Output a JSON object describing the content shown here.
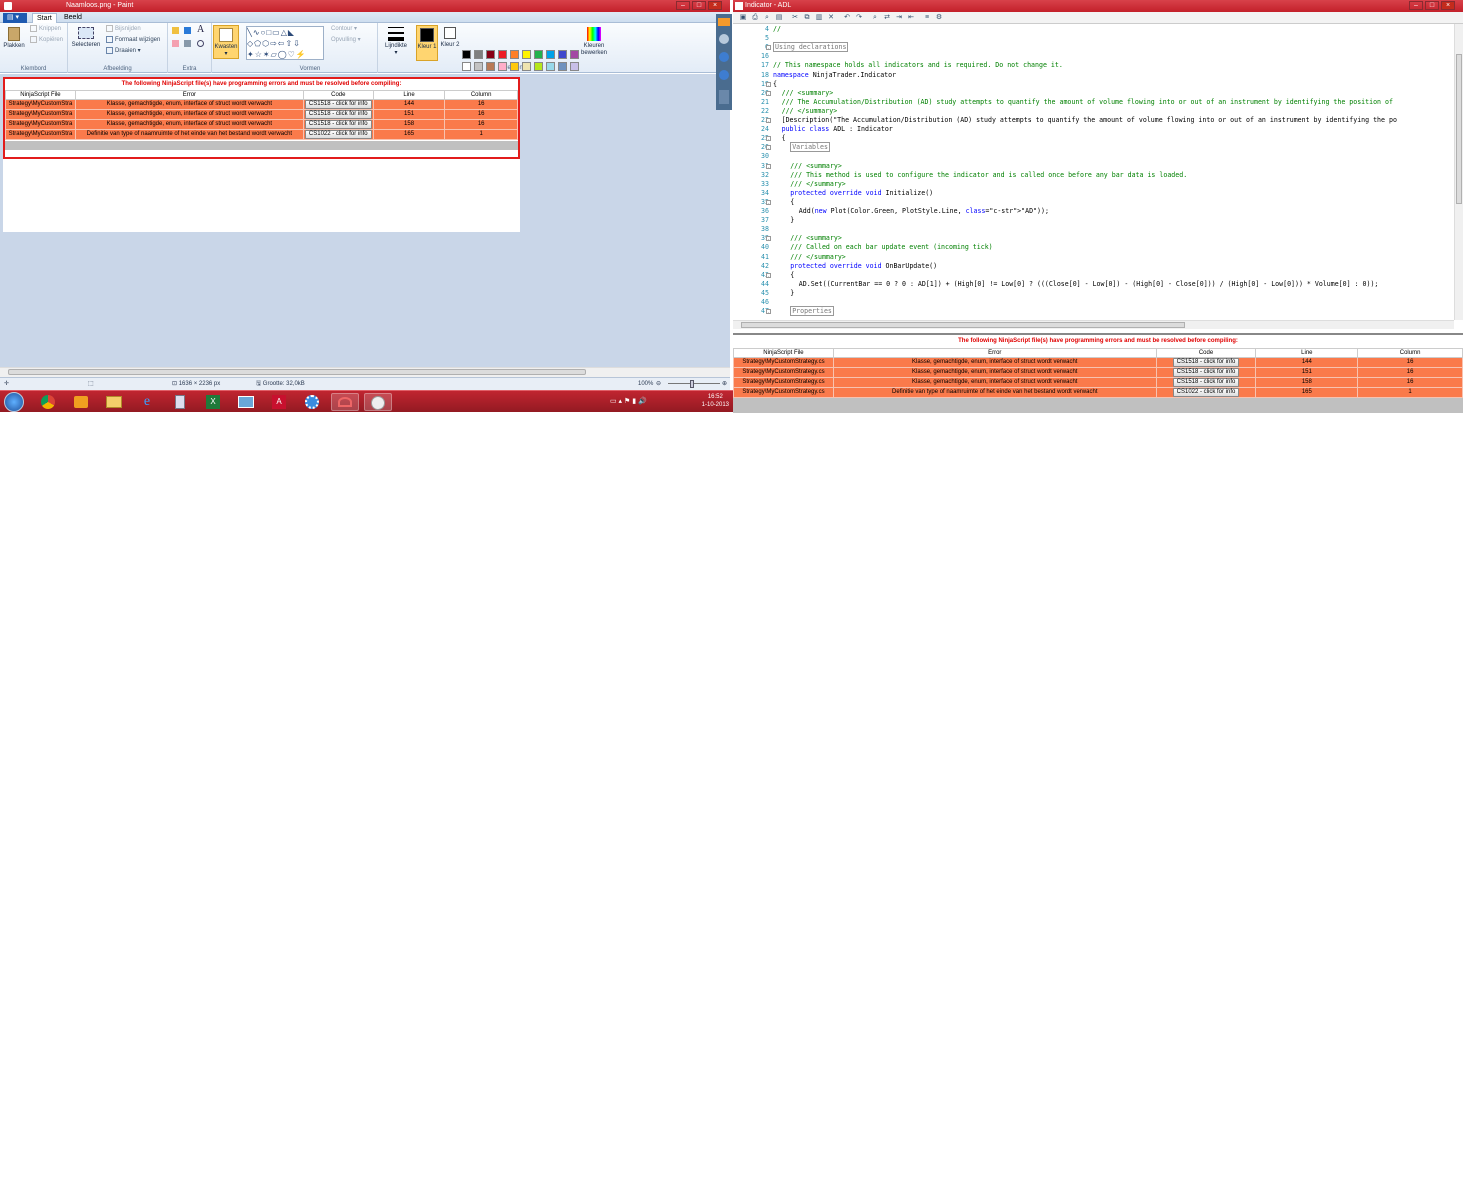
{
  "paint": {
    "title": "Naamloos.png - Paint",
    "tabs": [
      "Start",
      "Beeld"
    ],
    "groups": {
      "klembord": {
        "label": "Klembord",
        "paste": "Plakken",
        "cut": "Knippen",
        "copy": "Kopiëren"
      },
      "afbeelding": {
        "label": "Afbeelding",
        "select": "Selecteren",
        "crop": "Bijsnijden",
        "resize": "Formaat wijzigen",
        "rotate": "Draaien"
      },
      "extra": {
        "label": "Extra"
      },
      "brushes": {
        "label": "Kwasten"
      },
      "vormen": {
        "label": "Vormen",
        "contour": "Contour",
        "fill": "Opvulling"
      },
      "lijndikte": {
        "label": "Lijndikte"
      },
      "kleuren": {
        "label": "Kleuren",
        "color1": "Kleur 1",
        "color2": "Kleur 2",
        "edit": "Kleuren bewerken"
      }
    },
    "palette": [
      "#000000",
      "#7f7f7f",
      "#880015",
      "#ed1c24",
      "#ff7f27",
      "#fff200",
      "#22b14c",
      "#00a2e8",
      "#3f48cc",
      "#a349a4",
      "#ffffff",
      "#c3c3c3",
      "#b97a57",
      "#ffaec9",
      "#ffc90e",
      "#efe4b0",
      "#b5e61d",
      "#99d9ea",
      "#7092be",
      "#c8bfe7"
    ],
    "status": {
      "dimensions": "1636 × 2236 px",
      "size": "Grootte: 32,0kB",
      "zoom": "100%"
    }
  },
  "errors_small": {
    "title": "The following NinjaScript file(s) have programming errors and must be resolved before compiling:",
    "headers": [
      "NinjaScript File",
      "Error",
      "Code",
      "Line",
      "Column"
    ],
    "rows": [
      {
        "file": "Strategy\\MyCustomStra",
        "error": "Klasse, gemachtigde, enum, interface of struct wordt verwacht",
        "code": "CS1518 - click for info",
        "line": "144",
        "col": "16"
      },
      {
        "file": "Strategy\\MyCustomStra",
        "error": "Klasse, gemachtigde, enum, interface of struct wordt verwacht",
        "code": "CS1518 - click for info",
        "line": "151",
        "col": "16"
      },
      {
        "file": "Strategy\\MyCustomStra",
        "error": "Klasse, gemachtigde, enum, interface of struct wordt verwacht",
        "code": "CS1518 - click for info",
        "line": "158",
        "col": "16"
      },
      {
        "file": "Strategy\\MyCustomStra",
        "error": "Definitie van type of naamruimte of het einde van het bestand wordt verwacht",
        "code": "CS1022 - click for info",
        "line": "165",
        "col": "1"
      }
    ]
  },
  "ninja": {
    "title": "Indicator - ADL",
    "lines": [
      {
        "n": "4",
        "text": "//"
      },
      {
        "n": "5",
        "text": ""
      },
      {
        "n": "6",
        "text": "Using declarations"
      },
      {
        "n": "16",
        "text": ""
      },
      {
        "n": "17",
        "text": "// This namespace holds all indicators and is required. Do not change it."
      },
      {
        "n": "18",
        "text": "namespace NinjaTrader.Indicator"
      },
      {
        "n": "19",
        "text": "{"
      },
      {
        "n": "20",
        "text": "/// <summary>"
      },
      {
        "n": "21",
        "text": "/// The Accumulation/Distribution (AD) study attempts to quantify the amount of volume flowing into or out of an instrument by identifying the position of"
      },
      {
        "n": "22",
        "text": "/// </summary>"
      },
      {
        "n": "23",
        "text": "[Description(\"The Accumulation/Distribution (AD) study attempts to quantify the amount of volume flowing into or out of an instrument by identifying the po"
      },
      {
        "n": "24",
        "text": "public class ADL : Indicator"
      },
      {
        "n": "25",
        "text": "{"
      },
      {
        "n": "26",
        "text": "Variables"
      },
      {
        "n": "30",
        "text": ""
      },
      {
        "n": "31",
        "text": "/// <summary>"
      },
      {
        "n": "32",
        "text": "/// This method is used to configure the indicator and is called once before any bar data is loaded."
      },
      {
        "n": "33",
        "text": "/// </summary>"
      },
      {
        "n": "34",
        "text": "protected override void Initialize()"
      },
      {
        "n": "35",
        "text": "{"
      },
      {
        "n": "36",
        "text": "Add(new Plot(Color.Green, PlotStyle.Line, \"AD\"));"
      },
      {
        "n": "37",
        "text": "}"
      },
      {
        "n": "38",
        "text": ""
      },
      {
        "n": "39",
        "text": "/// <summary>"
      },
      {
        "n": "40",
        "text": "/// Called on each bar update event (incoming tick)"
      },
      {
        "n": "41",
        "text": "/// </summary>"
      },
      {
        "n": "42",
        "text": "protected override void OnBarUpdate()"
      },
      {
        "n": "43",
        "text": "{"
      },
      {
        "n": "44",
        "text": "AD.Set((CurrentBar == 0 ? 0 : AD[1]) + (High[0] != Low[0] ? (((Close[0] - Low[0]) - (High[0] - Close[0])) / (High[0] - Low[0])) * Volume[0] : 0));"
      },
      {
        "n": "45",
        "text": "}"
      },
      {
        "n": "46",
        "text": ""
      },
      {
        "n": "47",
        "text": "Properties"
      }
    ]
  },
  "errors_large": {
    "title": "The following NinjaScript file(s) have programming errors and must be resolved before compiling:",
    "headers": [
      "NinjaScript File",
      "Error",
      "Code",
      "Line",
      "Column"
    ],
    "rows": [
      {
        "file": "Strategy\\MyCustomStrategy.cs",
        "error": "Klasse, gemachtigde, enum, interface of struct wordt verwacht",
        "code": "CS1518 - click for info",
        "line": "144",
        "col": "16"
      },
      {
        "file": "Strategy\\MyCustomStrategy.cs",
        "error": "Klasse, gemachtigde, enum, interface of struct wordt verwacht",
        "code": "CS1518 - click for info",
        "line": "151",
        "col": "16"
      },
      {
        "file": "Strategy\\MyCustomStrategy.cs",
        "error": "Klasse, gemachtigde, enum, interface of struct wordt verwacht",
        "code": "CS1518 - click for info",
        "line": "158",
        "col": "16"
      },
      {
        "file": "Strategy\\MyCustomStrategy.cs",
        "error": "Definitie van type of naamruimte of het einde van het bestand wordt verwacht",
        "code": "CS1022 - click for info",
        "line": "165",
        "col": "1"
      }
    ]
  },
  "taskbar": {
    "time": "16:52",
    "date": "1-10-2013"
  }
}
